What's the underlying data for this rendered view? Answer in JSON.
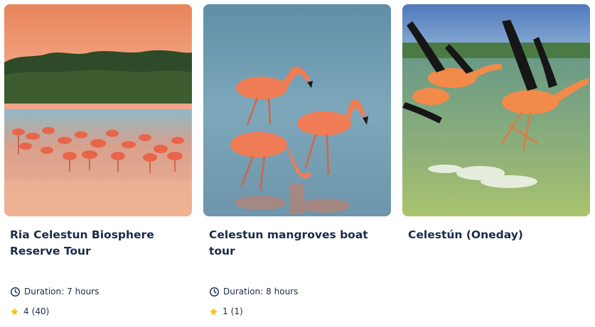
{
  "tours": [
    {
      "title": "Ria Celestun Biosphere Reserve Tour",
      "photo_icon": "flamingo-flock-photo",
      "duration_label": "Duration:",
      "duration_value": "7 hours",
      "rating": "4",
      "review_count": "(40)"
    },
    {
      "title": "Celestun mangroves boat tour",
      "photo_icon": "flamingos-wading-photo",
      "duration_label": "Duration:",
      "duration_value": "8 hours",
      "rating": "1",
      "review_count": "(1)"
    },
    {
      "title": "Celestún (Oneday)",
      "photo_icon": "flamingos-flying-photo",
      "duration_label": "",
      "duration_value": "",
      "rating": "",
      "review_count": ""
    }
  ],
  "colors": {
    "text": "#1a2b49",
    "star": "#ffc107"
  }
}
